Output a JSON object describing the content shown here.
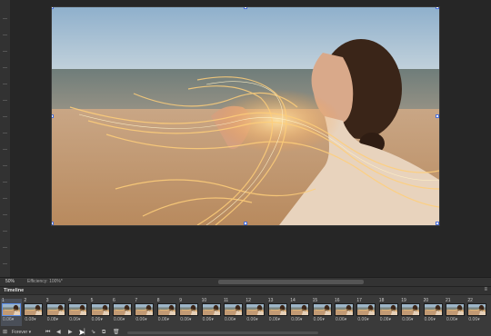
{
  "status": {
    "zoom": "50%",
    "efficiency": "Efficiency: 100%*"
  },
  "timeline": {
    "title": "Timeline",
    "menu_icon": "hamburger-menu-icon",
    "loop": "Forever ▾",
    "frames": [
      {
        "num": "1",
        "delay": "0.06▾"
      },
      {
        "num": "2",
        "delay": "0.08▾"
      },
      {
        "num": "3",
        "delay": "0.08▾"
      },
      {
        "num": "4",
        "delay": "0.06▾"
      },
      {
        "num": "5",
        "delay": "0.06▾"
      },
      {
        "num": "6",
        "delay": "0.06▾"
      },
      {
        "num": "7",
        "delay": "0.06▾"
      },
      {
        "num": "8",
        "delay": "0.06▾"
      },
      {
        "num": "9",
        "delay": "0.06▾"
      },
      {
        "num": "10",
        "delay": "0.06▾"
      },
      {
        "num": "11",
        "delay": "0.06▾"
      },
      {
        "num": "12",
        "delay": "0.06▾"
      },
      {
        "num": "13",
        "delay": "0.06▾"
      },
      {
        "num": "14",
        "delay": "0.06▾"
      },
      {
        "num": "15",
        "delay": "0.06▾"
      },
      {
        "num": "16",
        "delay": "0.06▾"
      },
      {
        "num": "17",
        "delay": "0.06▾"
      },
      {
        "num": "18",
        "delay": "0.06▾"
      },
      {
        "num": "19",
        "delay": "0.06▾"
      },
      {
        "num": "20",
        "delay": "0.06▾"
      },
      {
        "num": "21",
        "delay": "0.06▾"
      },
      {
        "num": "22",
        "delay": "0.06▾"
      }
    ],
    "controls": {
      "first_frame": "⏮",
      "prev_frame": "◀",
      "play": "▶",
      "next_frame": "▶▏",
      "tween": "⇘",
      "duplicate": "⧉",
      "delete": "🗑"
    }
  },
  "colors": {
    "selection_blue": "#4a6ed8",
    "panel_bg": "#3a3a3a",
    "canvas_bg": "#262626"
  }
}
